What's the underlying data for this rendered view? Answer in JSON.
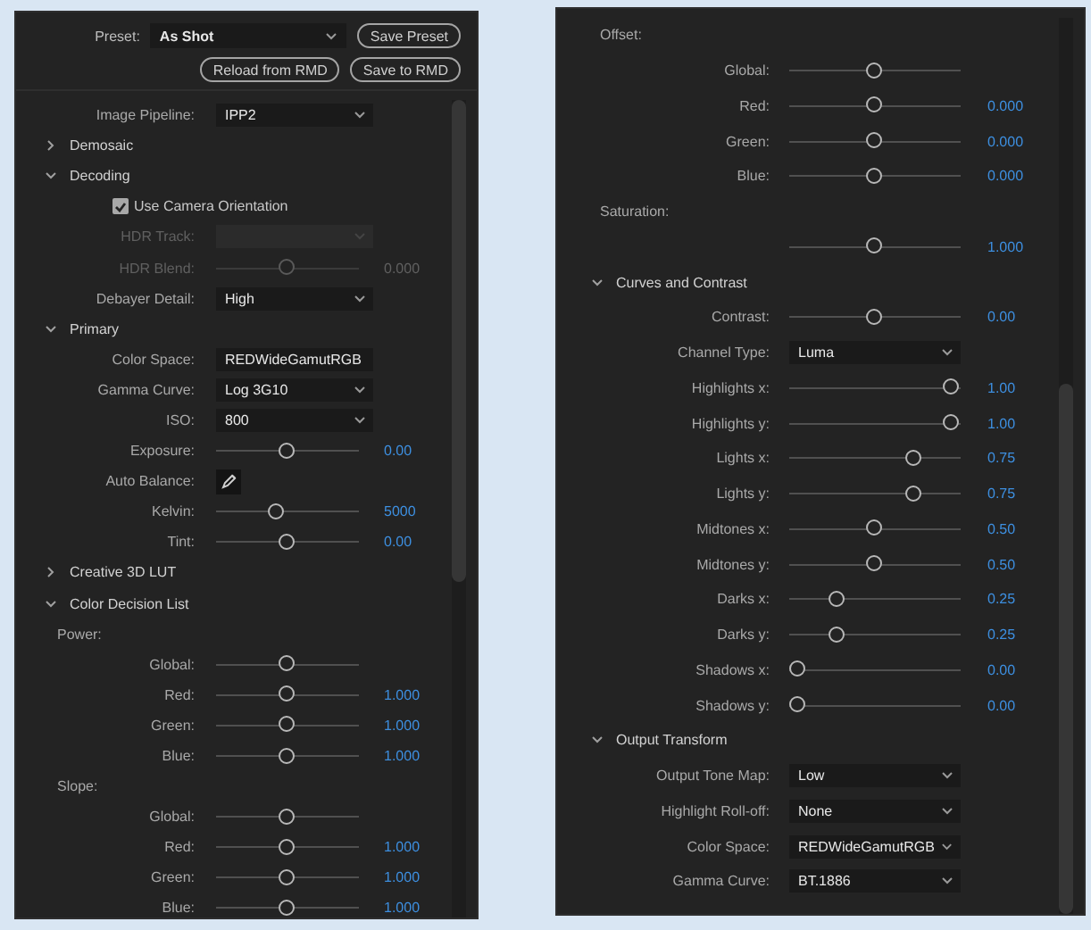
{
  "left_panel": {
    "preset": {
      "label": "Preset:",
      "value": "As Shot"
    },
    "buttons": [
      "Save Preset",
      "Reload from RMD",
      "Save to RMD"
    ],
    "rows": [
      {
        "kind": "dropdown",
        "label": "Image Pipeline:",
        "value": "IPP2",
        "disabled": false
      },
      {
        "kind": "section",
        "title": "Demosaic",
        "expanded": false
      },
      {
        "kind": "section",
        "title": "Decoding",
        "expanded": true
      },
      {
        "kind": "checkbox",
        "label": "Use Camera Orientation",
        "checked": true,
        "disabled": false
      },
      {
        "kind": "dropdown",
        "label": "HDR Track:",
        "disabled": true
      },
      {
        "kind": "slider",
        "label": "HDR Blend:",
        "level": 0.5,
        "reading": "0.000",
        "disabled": true
      },
      {
        "kind": "dropdown",
        "label": "Debayer Detail:",
        "value": "High",
        "disabled": false
      },
      {
        "kind": "section",
        "title": "Primary",
        "expanded": true
      },
      {
        "kind": "dropdown",
        "label": "Color Space:",
        "value": "REDWideGamutRGB",
        "disabled": false
      },
      {
        "kind": "dropdown",
        "label": "Gamma Curve:",
        "value": "Log 3G10",
        "disabled": false
      },
      {
        "kind": "dropdown",
        "label": "ISO:",
        "value": "800",
        "disabled": false
      },
      {
        "kind": "slider",
        "label": "Exposure:",
        "level": 0.5,
        "reading": "0.00",
        "disabled": false
      },
      {
        "kind": "eyedropper",
        "label": "Auto Balance:",
        "disabled": false
      },
      {
        "kind": "slider",
        "label": "Kelvin:",
        "level": 0.42,
        "reading": "5000",
        "disabled": false
      },
      {
        "kind": "slider",
        "label": "Tint:",
        "level": 0.5,
        "reading": "0.00",
        "disabled": false
      },
      {
        "kind": "section",
        "title": "Creative 3D LUT",
        "expanded": false
      },
      {
        "kind": "section",
        "title": "Color Decision List",
        "expanded": true
      },
      {
        "kind": "group",
        "title": "Power:"
      },
      {
        "kind": "slider",
        "label": "Global:",
        "level": 0.5,
        "disabled": false
      },
      {
        "kind": "slider",
        "label": "Red:",
        "level": 0.5,
        "reading": "1.000",
        "disabled": false
      },
      {
        "kind": "slider",
        "label": "Green:",
        "level": 0.5,
        "reading": "1.000",
        "disabled": false
      },
      {
        "kind": "slider",
        "label": "Blue:",
        "level": 0.5,
        "reading": "1.000",
        "disabled": false
      },
      {
        "kind": "group",
        "title": "Slope:"
      },
      {
        "kind": "slider",
        "label": "Global:",
        "level": 0.5,
        "disabled": false
      },
      {
        "kind": "slider",
        "label": "Red:",
        "level": 0.5,
        "reading": "1.000",
        "disabled": false
      },
      {
        "kind": "slider",
        "label": "Green:",
        "level": 0.5,
        "reading": "1.000",
        "disabled": false
      },
      {
        "kind": "slider",
        "label": "Blue:",
        "level": 0.5,
        "reading": "1.000",
        "disabled": false
      }
    ]
  },
  "right_panel": {
    "rows": [
      {
        "kind": "group",
        "title": "Offset:"
      },
      {
        "kind": "slider",
        "label": "Global:",
        "level": 0.5,
        "disabled": false
      },
      {
        "kind": "slider",
        "label": "Red:",
        "level": 0.5,
        "reading": "0.000",
        "disabled": false
      },
      {
        "kind": "slider",
        "label": "Green:",
        "level": 0.5,
        "reading": "0.000",
        "disabled": false
      },
      {
        "kind": "slider",
        "label": "Blue:",
        "level": 0.5,
        "reading": "0.000",
        "disabled": false
      },
      {
        "kind": "group",
        "title": "Saturation:"
      },
      {
        "kind": "slider",
        "level": 0.5,
        "reading": "1.000",
        "disabled": false
      },
      {
        "kind": "section",
        "title": "Curves and Contrast",
        "expanded": true
      },
      {
        "kind": "slider",
        "label": "Contrast:",
        "level": 0.5,
        "reading": "0.00",
        "disabled": false
      },
      {
        "kind": "dropdown",
        "label": "Channel Type:",
        "value": "Luma",
        "disabled": false
      },
      {
        "kind": "slider",
        "label": "Highlights x:",
        "level": 1,
        "reading": "1.00",
        "disabled": false
      },
      {
        "kind": "slider",
        "label": "Highlights y:",
        "level": 1,
        "reading": "1.00",
        "disabled": false
      },
      {
        "kind": "slider",
        "label": "Lights x:",
        "level": 0.75,
        "reading": "0.75",
        "disabled": false
      },
      {
        "kind": "slider",
        "label": "Lights y:",
        "level": 0.75,
        "reading": "0.75",
        "disabled": false
      },
      {
        "kind": "slider",
        "label": "Midtones x:",
        "level": 0.5,
        "reading": "0.50",
        "disabled": false
      },
      {
        "kind": "slider",
        "label": "Midtones y:",
        "level": 0.5,
        "reading": "0.50",
        "disabled": false
      },
      {
        "kind": "slider",
        "label": "Darks x:",
        "level": 0.25,
        "reading": "0.25",
        "disabled": false
      },
      {
        "kind": "slider",
        "label": "Darks y:",
        "level": 0.25,
        "reading": "0.25",
        "disabled": false
      },
      {
        "kind": "slider",
        "label": "Shadows x:",
        "level": 0,
        "reading": "0.00",
        "disabled": false
      },
      {
        "kind": "slider",
        "label": "Shadows y:",
        "level": 0,
        "reading": "0.00",
        "disabled": false
      },
      {
        "kind": "section",
        "title": "Output Transform",
        "expanded": true
      },
      {
        "kind": "dropdown",
        "label": "Output Tone Map:",
        "value": "Low",
        "disabled": false
      },
      {
        "kind": "dropdown",
        "label": "Highlight Roll-off:",
        "value": "None",
        "disabled": false
      },
      {
        "kind": "dropdown",
        "label": "Color Space:",
        "value": "REDWideGamutRGB",
        "disabled": false
      },
      {
        "kind": "dropdown",
        "label": "Gamma Curve:",
        "value": "BT.1886",
        "disabled": false
      }
    ]
  }
}
